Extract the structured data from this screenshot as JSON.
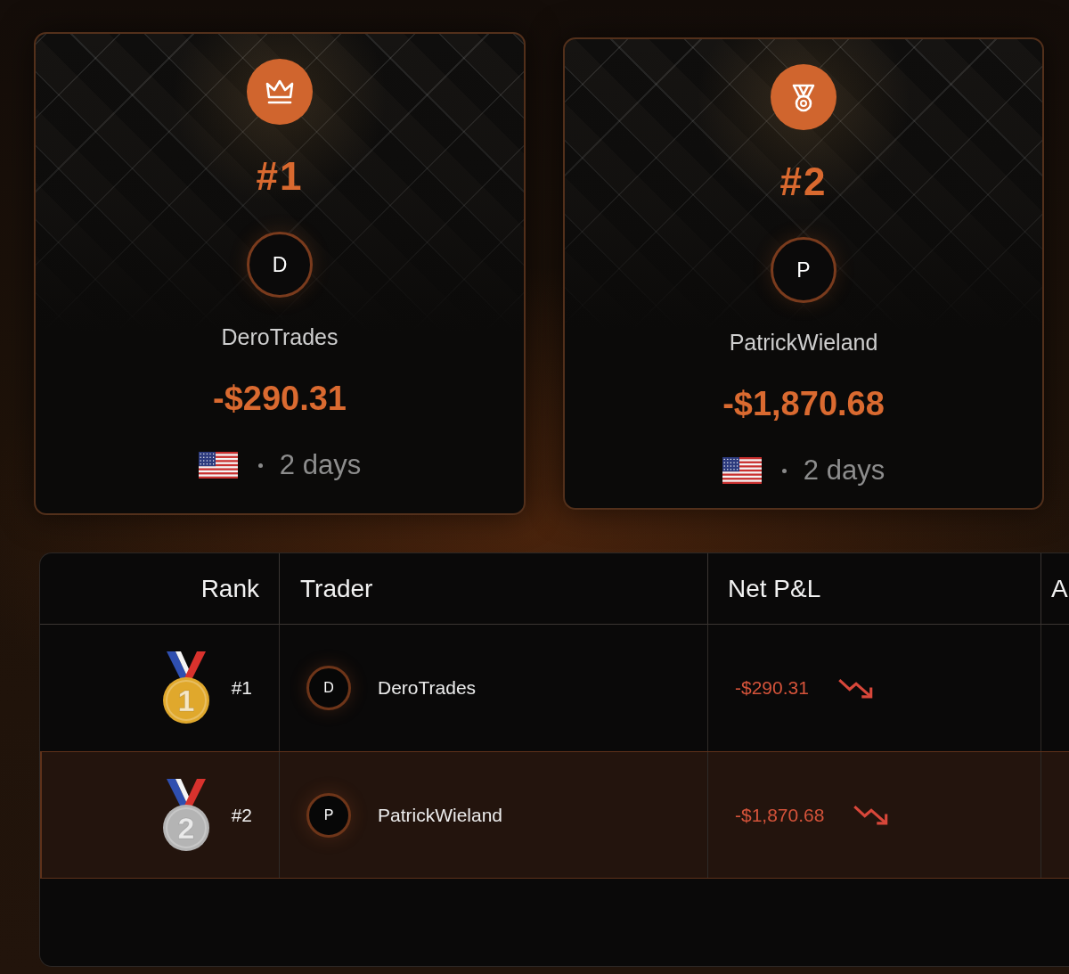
{
  "podium": [
    {
      "rank": "#1",
      "initial": "D",
      "name": "DeroTrades",
      "pnl": "-$290.31",
      "time": "2 days"
    },
    {
      "rank": "#2",
      "initial": "P",
      "name": "PatrickWieland",
      "pnl": "-$1,870.68",
      "time": "2 days"
    }
  ],
  "table": {
    "columns": [
      "Rank",
      "Trader",
      "Net P&L",
      "A"
    ],
    "rows": [
      {
        "selected": false,
        "medal": {
          "number": "1",
          "color": "#e0a82c"
        },
        "rank": "#1",
        "initial": "D",
        "trader": "DeroTrades",
        "net_pnl": "-$290.31",
        "negative": true
      },
      {
        "selected": true,
        "medal": {
          "number": "2",
          "color": "#b4b4b4"
        },
        "rank": "#2",
        "initial": "P",
        "trader": "PatrickWieland",
        "net_pnl": "-$1,870.68",
        "negative": true
      }
    ]
  }
}
